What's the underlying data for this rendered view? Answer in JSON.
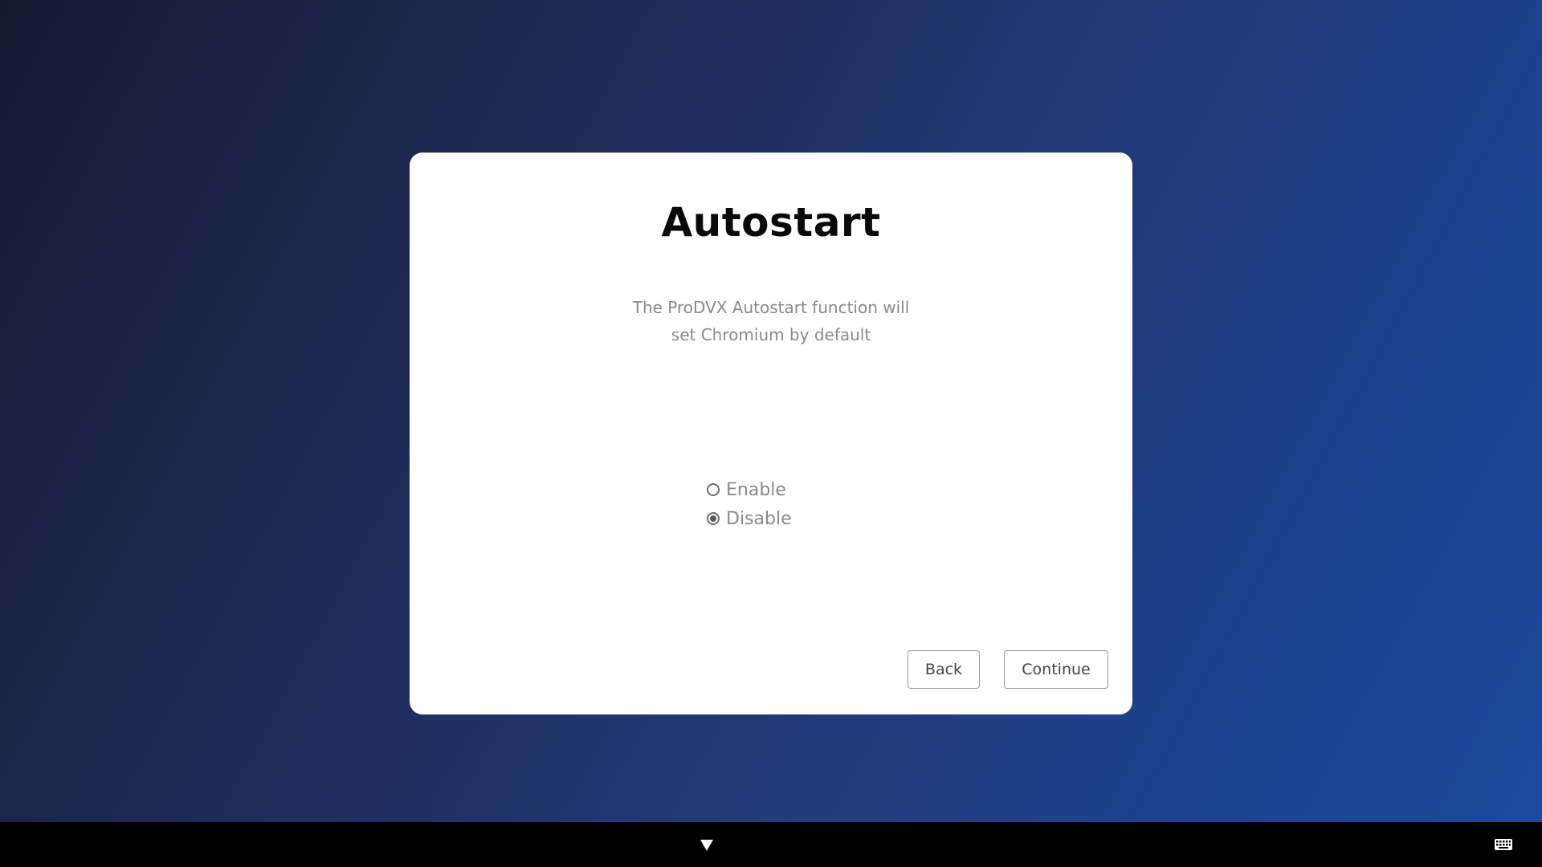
{
  "dialog": {
    "title": "Autostart",
    "description_lines": [
      "The ProDVX Autostart function will",
      "set Chromium by default"
    ],
    "options": [
      {
        "label": "Enable",
        "checked": false
      },
      {
        "label": "Disable",
        "checked": true
      }
    ],
    "back_label": "Back",
    "continue_label": "Continue"
  },
  "navbar": {
    "icons": [
      "chevron-down-icon",
      "keyboard-icon"
    ]
  },
  "colors": {
    "background_dark": "#151b33",
    "background_light": "#1d4a9b",
    "dialog_bg": "#ffffff",
    "text_muted": "#8a8a8a",
    "navbar_bg": "#000000"
  }
}
